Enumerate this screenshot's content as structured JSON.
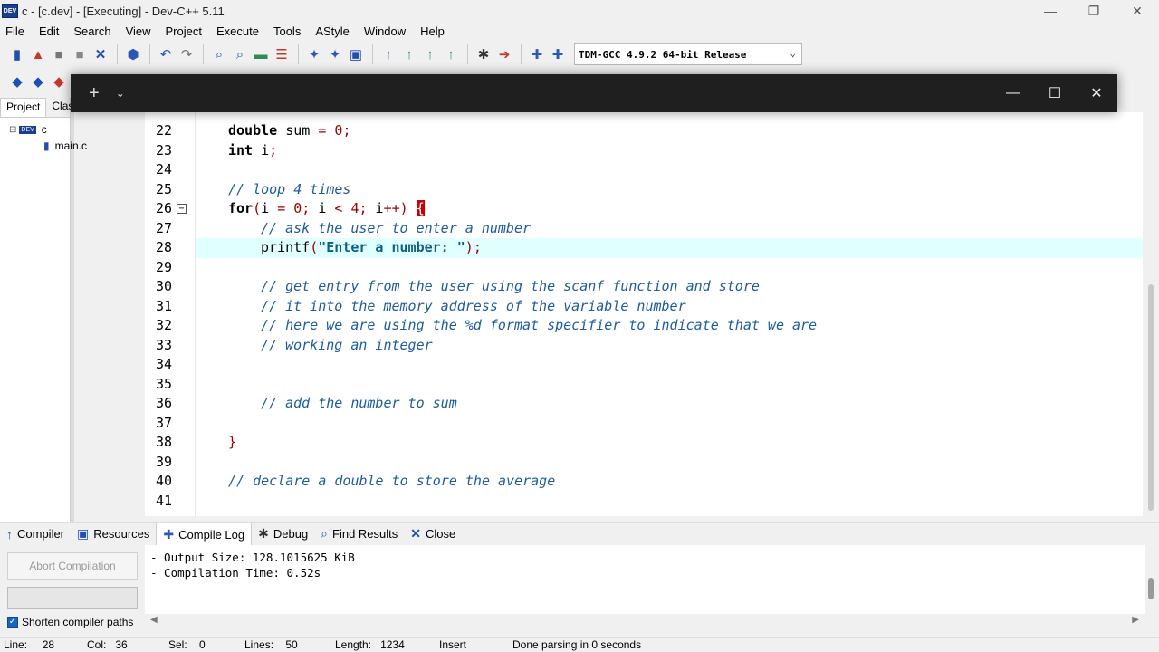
{
  "window": {
    "title": "c - [c.dev] - [Executing] - Dev-C++ 5.11",
    "icon_label": "DEV"
  },
  "menu": [
    "File",
    "Edit",
    "Search",
    "View",
    "Project",
    "Execute",
    "Tools",
    "AStyle",
    "Window",
    "Help"
  ],
  "toolbar": {
    "compiler": "TDM-GCC 4.9.2 64-bit Release"
  },
  "left_panel": {
    "tabs": [
      "Project",
      "Clas"
    ],
    "tree": {
      "project": "c",
      "file": "main.c"
    }
  },
  "editor": {
    "lines": [
      {
        "n": "22",
        "kind": "decl1"
      },
      {
        "n": "23",
        "kind": "decl2"
      },
      {
        "n": "24",
        "kind": "blank"
      },
      {
        "n": "25",
        "kind": "comment",
        "text": "// loop 4 times",
        "indent": 1
      },
      {
        "n": "26",
        "kind": "for"
      },
      {
        "n": "27",
        "kind": "comment",
        "text": "// ask the user to enter a number",
        "indent": 2
      },
      {
        "n": "28",
        "kind": "printf"
      },
      {
        "n": "29",
        "kind": "blank"
      },
      {
        "n": "30",
        "kind": "comment",
        "text": "// get entry from the user using the scanf function and store",
        "indent": 2
      },
      {
        "n": "31",
        "kind": "comment",
        "text": "// it into the memory address of the variable number",
        "indent": 2
      },
      {
        "n": "32",
        "kind": "comment",
        "text": "// here we are using the %d format specifier to indicate that we are",
        "indent": 2
      },
      {
        "n": "33",
        "kind": "comment",
        "text": "// working an integer",
        "indent": 2
      },
      {
        "n": "34",
        "kind": "blank"
      },
      {
        "n": "35",
        "kind": "blank"
      },
      {
        "n": "36",
        "kind": "comment",
        "text": "// add the number to sum",
        "indent": 2
      },
      {
        "n": "37",
        "kind": "blank"
      },
      {
        "n": "38",
        "kind": "close"
      },
      {
        "n": "39",
        "kind": "blank"
      },
      {
        "n": "40",
        "kind": "comment",
        "text": "// declare a double to store the average",
        "indent": 1
      },
      {
        "n": "41",
        "kind": "blank"
      }
    ],
    "tokens": {
      "double": "double",
      "sum": " sum ",
      "eq": "=",
      "zero": " 0",
      "semi": ";",
      "int": "int",
      "i": " i",
      "for": "for",
      "for_open": "(",
      "for_i": "i ",
      "for_eq": "=",
      "for_zero": " 0",
      "for_semi1": ";",
      "for_i2": " i ",
      "for_lt": "<",
      "for_four": " 4",
      "for_semi2": ";",
      "for_inc": " i",
      "for_pp": "++",
      "for_close": ")",
      "brace_open": "{",
      "printf": "printf",
      "paren_open": "(",
      "string": "\"Enter a number: \"",
      "paren_close": ")",
      "semi2": ";",
      "brace_close": "}"
    },
    "current_line": "28"
  },
  "terminal": {
    "plus": "+",
    "chevron": "⌄",
    "minimize": "—",
    "maximize": "☐",
    "close": "✕"
  },
  "bottom_tabs": [
    "Compiler",
    "Resources",
    "Compile Log",
    "Debug",
    "Find Results",
    "Close"
  ],
  "bottom_active_tab": "Compile Log",
  "compile_log": {
    "abort_button": "Abort Compilation",
    "shorten_label": "Shorten compiler paths",
    "shorten_checked": true,
    "lines": [
      "- Output Size: 128.1015625 KiB",
      "- Compilation Time: 0.52s"
    ]
  },
  "status": {
    "line_label": "Line:",
    "line": "28",
    "col_label": "Col:",
    "col": "36",
    "sel_label": "Sel:",
    "sel": "0",
    "lines_label": "Lines:",
    "lines": "50",
    "length_label": "Length:",
    "length": "1234",
    "mode": "Insert",
    "parse": "Done parsing in 0 seconds"
  }
}
